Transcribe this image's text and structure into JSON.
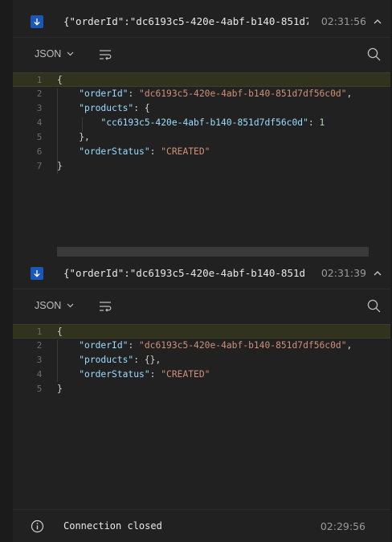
{
  "messages": [
    {
      "title": "{\"orderId\":\"dc6193c5-420e-4abf-b140-851d7…",
      "time": "02:31:56",
      "direction_icon": "arrow-down-icon",
      "format_label": "JSON",
      "lines": [
        {
          "n": "1",
          "tokens": [
            {
              "t": "p",
              "v": "{"
            }
          ]
        },
        {
          "n": "2",
          "tokens": [
            {
              "t": "p",
              "v": "    "
            },
            {
              "t": "k",
              "v": "\"orderId\""
            },
            {
              "t": "p",
              "v": ": "
            },
            {
              "t": "s",
              "v": "\"dc6193c5-420e-4abf-b140-851d7df56c0d\""
            },
            {
              "t": "p",
              "v": ","
            }
          ]
        },
        {
          "n": "3",
          "tokens": [
            {
              "t": "p",
              "v": "    "
            },
            {
              "t": "k",
              "v": "\"products\""
            },
            {
              "t": "p",
              "v": ": {"
            }
          ]
        },
        {
          "n": "4",
          "tokens": [
            {
              "t": "p",
              "v": "        "
            },
            {
              "t": "k",
              "v": "\"cc6193c5-420e-4abf-b140-851d7df56c0d\""
            },
            {
              "t": "p",
              "v": ": "
            },
            {
              "t": "n",
              "v": "1"
            }
          ]
        },
        {
          "n": "5",
          "tokens": [
            {
              "t": "p",
              "v": "    },"
            }
          ]
        },
        {
          "n": "6",
          "tokens": [
            {
              "t": "p",
              "v": "    "
            },
            {
              "t": "k",
              "v": "\"orderStatus\""
            },
            {
              "t": "p",
              "v": ": "
            },
            {
              "t": "s",
              "v": "\"CREATED\""
            }
          ]
        },
        {
          "n": "7",
          "tokens": [
            {
              "t": "p",
              "v": "}"
            }
          ]
        }
      ]
    },
    {
      "title": "{\"orderId\":\"dc6193c5-420e-4abf-b140-851d…",
      "time": "02:31:39",
      "direction_icon": "arrow-down-icon",
      "format_label": "JSON",
      "lines": [
        {
          "n": "1",
          "tokens": [
            {
              "t": "p",
              "v": "{"
            }
          ]
        },
        {
          "n": "2",
          "tokens": [
            {
              "t": "p",
              "v": "    "
            },
            {
              "t": "k",
              "v": "\"orderId\""
            },
            {
              "t": "p",
              "v": ": "
            },
            {
              "t": "s",
              "v": "\"dc6193c5-420e-4abf-b140-851d7df56c0d\""
            },
            {
              "t": "p",
              "v": ","
            }
          ]
        },
        {
          "n": "3",
          "tokens": [
            {
              "t": "p",
              "v": "    "
            },
            {
              "t": "k",
              "v": "\"products\""
            },
            {
              "t": "p",
              "v": ": {},"
            }
          ]
        },
        {
          "n": "4",
          "tokens": [
            {
              "t": "p",
              "v": "    "
            },
            {
              "t": "k",
              "v": "\"orderStatus\""
            },
            {
              "t": "p",
              "v": ": "
            },
            {
              "t": "s",
              "v": "\"CREATED\""
            }
          ]
        },
        {
          "n": "5",
          "tokens": [
            {
              "t": "p",
              "v": "}"
            }
          ]
        }
      ]
    }
  ],
  "status": {
    "icon": "info-icon",
    "text": "Connection closed",
    "time": "02:29:56"
  },
  "colors": {
    "background": "#212121",
    "badge": "#1a57b8",
    "json_key": "#9cdcfe",
    "json_string": "#ce9178",
    "json_number": "#b5cea8",
    "active_line": "#32331f"
  }
}
